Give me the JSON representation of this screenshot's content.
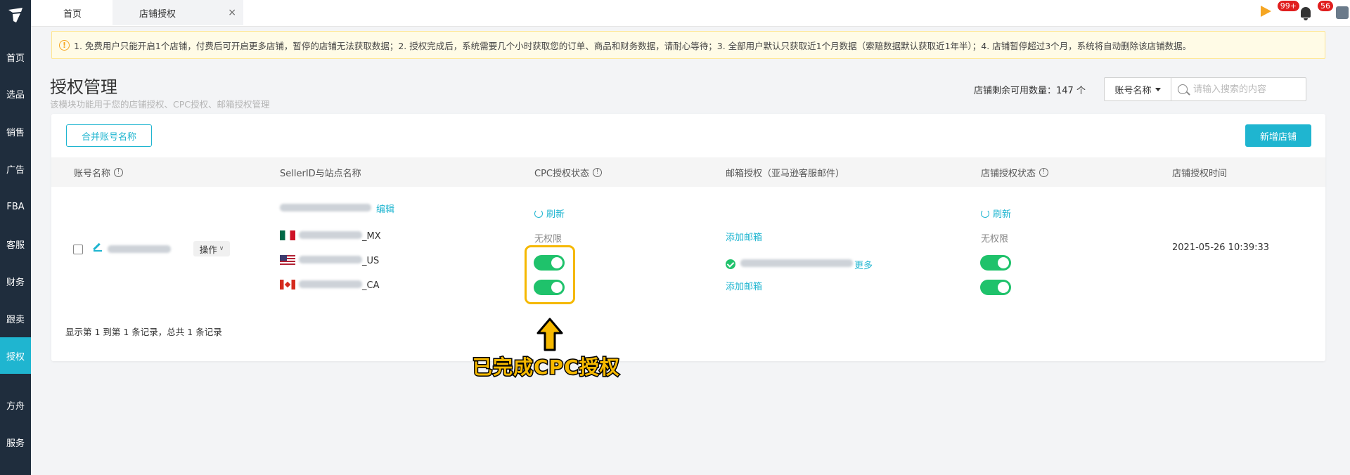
{
  "sidebar": {
    "items": [
      {
        "label": "首页",
        "active": false
      },
      {
        "label": "选品",
        "active": false
      },
      {
        "label": "销售",
        "active": false
      },
      {
        "label": "广告",
        "active": false
      },
      {
        "label": "FBA",
        "active": false
      },
      {
        "label": "客服",
        "active": false
      },
      {
        "label": "财务",
        "active": false
      },
      {
        "label": "跟卖",
        "active": false
      },
      {
        "label": "授权",
        "active": true
      },
      {
        "label": "方舟",
        "active": false
      },
      {
        "label": "服务",
        "active": false
      }
    ]
  },
  "tabs": {
    "home": "首页",
    "active": "店铺授权",
    "close": "×"
  },
  "header": {
    "notification_badge": "99+",
    "message_badge": "56"
  },
  "notice": {
    "icon": "!",
    "text": "1. 免费用户只能开启1个店铺，付费后可开启更多店铺，暂停的店铺无法获取数据；2. 授权完成后，系统需要几个小时获取您的订单、商品和财务数据，请耐心等待；3. 全部用户默认只获取近1个月数据（索赔数据默认获取近1年半）；4. 店铺暂停超过3个月，系统将自动删除该店铺数据。"
  },
  "page": {
    "title": "授权管理",
    "subtitle": "该模块功能用于您的店铺授权、CPC授权、邮箱授权管理",
    "remaining": "店铺剩余可用数量：147 个"
  },
  "search": {
    "select_label": "账号名称",
    "placeholder": "请输入搜索的内容"
  },
  "toolbar": {
    "merge_label": "合并账号名称",
    "add_label": "新增店铺"
  },
  "table": {
    "headers": {
      "account": "账号名称",
      "seller": "SellerID与站点名称",
      "cpc": "CPC授权状态",
      "email": "邮箱授权（亚马逊客服邮件）",
      "store": "店铺授权状态",
      "time": "店铺授权时间"
    },
    "row": {
      "operate": "操作",
      "edit_link": "编辑",
      "sites": [
        "_MX",
        "_US",
        "_CA"
      ],
      "refresh": "刷新",
      "unlimited": "无权限",
      "add_email": "添加邮箱",
      "more": "更多",
      "time": "2021-05-26 10:39:33"
    },
    "footer": "显示第 1 到第 1 条记录，总共 1 条记录"
  },
  "annotation": {
    "text": "已完成CPC授权"
  }
}
